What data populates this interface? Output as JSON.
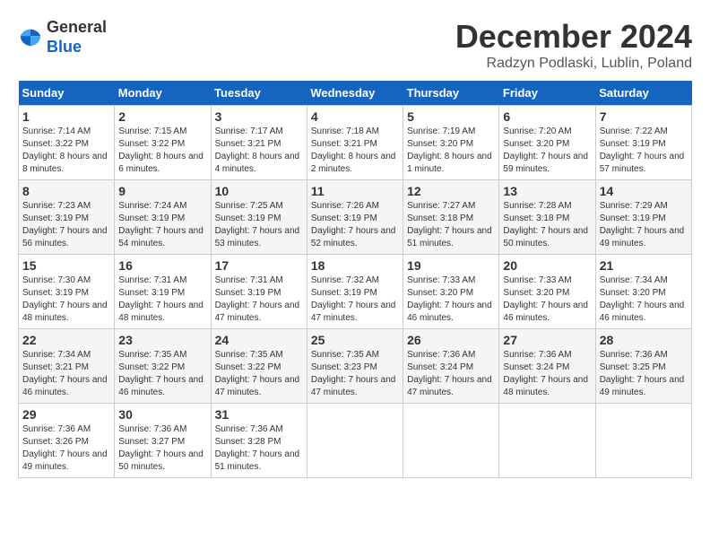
{
  "header": {
    "logo": {
      "general": "General",
      "blue": "Blue"
    },
    "title": "December 2024",
    "subtitle": "Radzyn Podlaski, Lublin, Poland"
  },
  "weekdays": [
    "Sunday",
    "Monday",
    "Tuesday",
    "Wednesday",
    "Thursday",
    "Friday",
    "Saturday"
  ],
  "weeks": [
    [
      {
        "day": "1",
        "sunrise": "Sunrise: 7:14 AM",
        "sunset": "Sunset: 3:22 PM",
        "daylight": "Daylight: 8 hours and 8 minutes."
      },
      {
        "day": "2",
        "sunrise": "Sunrise: 7:15 AM",
        "sunset": "Sunset: 3:22 PM",
        "daylight": "Daylight: 8 hours and 6 minutes."
      },
      {
        "day": "3",
        "sunrise": "Sunrise: 7:17 AM",
        "sunset": "Sunset: 3:21 PM",
        "daylight": "Daylight: 8 hours and 4 minutes."
      },
      {
        "day": "4",
        "sunrise": "Sunrise: 7:18 AM",
        "sunset": "Sunset: 3:21 PM",
        "daylight": "Daylight: 8 hours and 2 minutes."
      },
      {
        "day": "5",
        "sunrise": "Sunrise: 7:19 AM",
        "sunset": "Sunset: 3:20 PM",
        "daylight": "Daylight: 8 hours and 1 minute."
      },
      {
        "day": "6",
        "sunrise": "Sunrise: 7:20 AM",
        "sunset": "Sunset: 3:20 PM",
        "daylight": "Daylight: 7 hours and 59 minutes."
      },
      {
        "day": "7",
        "sunrise": "Sunrise: 7:22 AM",
        "sunset": "Sunset: 3:19 PM",
        "daylight": "Daylight: 7 hours and 57 minutes."
      }
    ],
    [
      {
        "day": "8",
        "sunrise": "Sunrise: 7:23 AM",
        "sunset": "Sunset: 3:19 PM",
        "daylight": "Daylight: 7 hours and 56 minutes."
      },
      {
        "day": "9",
        "sunrise": "Sunrise: 7:24 AM",
        "sunset": "Sunset: 3:19 PM",
        "daylight": "Daylight: 7 hours and 54 minutes."
      },
      {
        "day": "10",
        "sunrise": "Sunrise: 7:25 AM",
        "sunset": "Sunset: 3:19 PM",
        "daylight": "Daylight: 7 hours and 53 minutes."
      },
      {
        "day": "11",
        "sunrise": "Sunrise: 7:26 AM",
        "sunset": "Sunset: 3:19 PM",
        "daylight": "Daylight: 7 hours and 52 minutes."
      },
      {
        "day": "12",
        "sunrise": "Sunrise: 7:27 AM",
        "sunset": "Sunset: 3:18 PM",
        "daylight": "Daylight: 7 hours and 51 minutes."
      },
      {
        "day": "13",
        "sunrise": "Sunrise: 7:28 AM",
        "sunset": "Sunset: 3:18 PM",
        "daylight": "Daylight: 7 hours and 50 minutes."
      },
      {
        "day": "14",
        "sunrise": "Sunrise: 7:29 AM",
        "sunset": "Sunset: 3:19 PM",
        "daylight": "Daylight: 7 hours and 49 minutes."
      }
    ],
    [
      {
        "day": "15",
        "sunrise": "Sunrise: 7:30 AM",
        "sunset": "Sunset: 3:19 PM",
        "daylight": "Daylight: 7 hours and 48 minutes."
      },
      {
        "day": "16",
        "sunrise": "Sunrise: 7:31 AM",
        "sunset": "Sunset: 3:19 PM",
        "daylight": "Daylight: 7 hours and 48 minutes."
      },
      {
        "day": "17",
        "sunrise": "Sunrise: 7:31 AM",
        "sunset": "Sunset: 3:19 PM",
        "daylight": "Daylight: 7 hours and 47 minutes."
      },
      {
        "day": "18",
        "sunrise": "Sunrise: 7:32 AM",
        "sunset": "Sunset: 3:19 PM",
        "daylight": "Daylight: 7 hours and 47 minutes."
      },
      {
        "day": "19",
        "sunrise": "Sunrise: 7:33 AM",
        "sunset": "Sunset: 3:20 PM",
        "daylight": "Daylight: 7 hours and 46 minutes."
      },
      {
        "day": "20",
        "sunrise": "Sunrise: 7:33 AM",
        "sunset": "Sunset: 3:20 PM",
        "daylight": "Daylight: 7 hours and 46 minutes."
      },
      {
        "day": "21",
        "sunrise": "Sunrise: 7:34 AM",
        "sunset": "Sunset: 3:20 PM",
        "daylight": "Daylight: 7 hours and 46 minutes."
      }
    ],
    [
      {
        "day": "22",
        "sunrise": "Sunrise: 7:34 AM",
        "sunset": "Sunset: 3:21 PM",
        "daylight": "Daylight: 7 hours and 46 minutes."
      },
      {
        "day": "23",
        "sunrise": "Sunrise: 7:35 AM",
        "sunset": "Sunset: 3:22 PM",
        "daylight": "Daylight: 7 hours and 46 minutes."
      },
      {
        "day": "24",
        "sunrise": "Sunrise: 7:35 AM",
        "sunset": "Sunset: 3:22 PM",
        "daylight": "Daylight: 7 hours and 47 minutes."
      },
      {
        "day": "25",
        "sunrise": "Sunrise: 7:35 AM",
        "sunset": "Sunset: 3:23 PM",
        "daylight": "Daylight: 7 hours and 47 minutes."
      },
      {
        "day": "26",
        "sunrise": "Sunrise: 7:36 AM",
        "sunset": "Sunset: 3:24 PM",
        "daylight": "Daylight: 7 hours and 47 minutes."
      },
      {
        "day": "27",
        "sunrise": "Sunrise: 7:36 AM",
        "sunset": "Sunset: 3:24 PM",
        "daylight": "Daylight: 7 hours and 48 minutes."
      },
      {
        "day": "28",
        "sunrise": "Sunrise: 7:36 AM",
        "sunset": "Sunset: 3:25 PM",
        "daylight": "Daylight: 7 hours and 49 minutes."
      }
    ],
    [
      {
        "day": "29",
        "sunrise": "Sunrise: 7:36 AM",
        "sunset": "Sunset: 3:26 PM",
        "daylight": "Daylight: 7 hours and 49 minutes."
      },
      {
        "day": "30",
        "sunrise": "Sunrise: 7:36 AM",
        "sunset": "Sunset: 3:27 PM",
        "daylight": "Daylight: 7 hours and 50 minutes."
      },
      {
        "day": "31",
        "sunrise": "Sunrise: 7:36 AM",
        "sunset": "Sunset: 3:28 PM",
        "daylight": "Daylight: 7 hours and 51 minutes."
      },
      null,
      null,
      null,
      null
    ]
  ]
}
